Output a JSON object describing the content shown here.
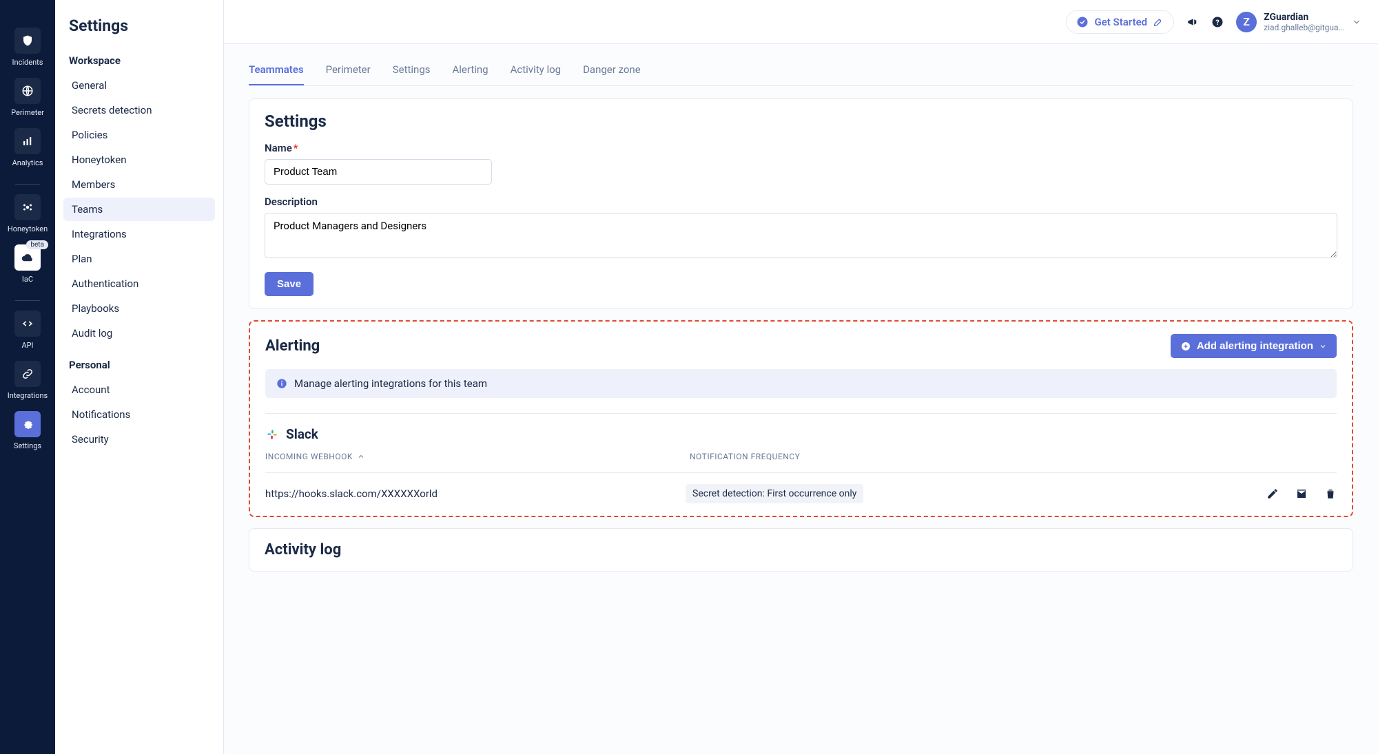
{
  "rail": {
    "items": [
      {
        "label": "Incidents"
      },
      {
        "label": "Perimeter"
      },
      {
        "label": "Analytics"
      },
      {
        "label": "Honeytoken"
      },
      {
        "label": "IaC",
        "beta": "beta"
      },
      {
        "label": "API"
      },
      {
        "label": "Integrations"
      },
      {
        "label": "Settings"
      }
    ]
  },
  "sidebar": {
    "title": "Settings",
    "group_workspace": "Workspace",
    "workspace_items": [
      "General",
      "Secrets detection",
      "Policies",
      "Honeytoken",
      "Members",
      "Teams",
      "Integrations",
      "Plan",
      "Authentication",
      "Playbooks",
      "Audit log"
    ],
    "group_personal": "Personal",
    "personal_items": [
      "Account",
      "Notifications",
      "Security"
    ]
  },
  "topbar": {
    "get_started": "Get Started",
    "user_initial": "Z",
    "user_name": "ZGuardian",
    "user_email": "ziad.ghalleb@gitgua..."
  },
  "tabs": [
    "Teammates",
    "Perimeter",
    "Settings",
    "Alerting",
    "Activity log",
    "Danger zone"
  ],
  "settings": {
    "heading": "Settings",
    "name_label": "Name",
    "name_value": "Product Team",
    "desc_label": "Description",
    "desc_value": "Product Managers and Designers",
    "save": "Save"
  },
  "alerting": {
    "heading": "Alerting",
    "add_btn": "Add alerting integration",
    "info_text": "Manage alerting integrations for this team",
    "slack_name": "Slack",
    "th_webhook": "INCOMING WEBHOOK",
    "th_freq": "NOTIFICATION FREQUENCY",
    "webhook_url": "https://hooks.slack.com/XXXXXXorld",
    "freq_chip": "Secret detection: First occurrence only"
  },
  "activity": {
    "heading": "Activity log"
  }
}
